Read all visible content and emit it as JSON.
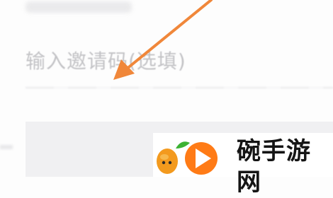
{
  "form": {
    "invite_code_placeholder": "输入邀请码(选填)"
  },
  "watermark": {
    "text": "碗手游网",
    "orange_color": "#f39a1e",
    "play_color": "#ff7b16",
    "leaf_color": "#3cb233"
  },
  "annotation": {
    "arrow_color": "#f0873a"
  }
}
